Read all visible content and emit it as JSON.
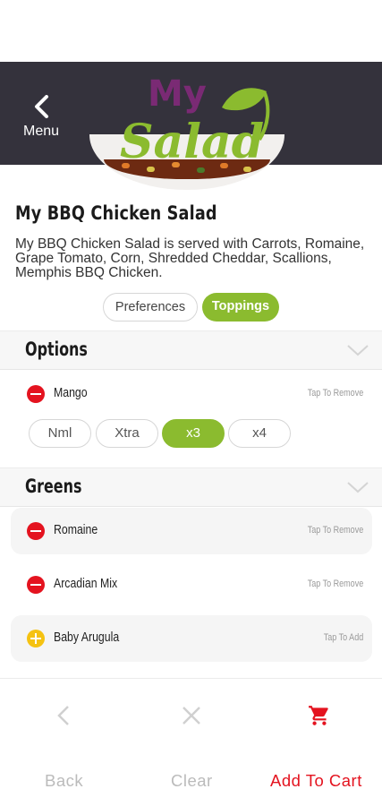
{
  "header": {
    "menu_label": "Menu",
    "logo_text_top": "My",
    "logo_text_bottom": "Salad",
    "brand_green": "#8bbb2f",
    "brand_purple": "#7a2a74"
  },
  "product": {
    "title": "My BBQ Chicken Salad",
    "description": "My BBQ Chicken Salad is served with Carrots, Romaine, Grape Tomato, Corn, Shredded Cheddar, Scallions, Memphis BBQ Chicken."
  },
  "tabs": {
    "preferences": "Preferences",
    "toppings": "Toppings",
    "active": "Toppings"
  },
  "sections": {
    "options": {
      "heading": "Options",
      "items": [
        {
          "name": "Mango",
          "action": "Tap To Remove",
          "icon": "remove-icon"
        }
      ],
      "quantity_options": [
        "Nml",
        "Xtra",
        "x3",
        "x4"
      ],
      "selected_quantity": "x3"
    },
    "greens": {
      "heading": "Greens",
      "items": [
        {
          "name": "Romaine",
          "action": "Tap To Remove",
          "icon": "remove-icon"
        },
        {
          "name": "Arcadian Mix",
          "action": "Tap To Remove",
          "icon": "remove-icon"
        },
        {
          "name": "Baby Arugula",
          "action": "Tap To Add",
          "icon": "add-icon"
        }
      ]
    }
  },
  "bottom_nav": {
    "back": "Back",
    "clear": "Clear",
    "add_to_cart": "Add To Cart"
  },
  "colors": {
    "header_bg": "#34323c",
    "accent_green": "#8bbb2f",
    "remove_red": "#e4131f",
    "add_yellow": "#f5c211"
  }
}
